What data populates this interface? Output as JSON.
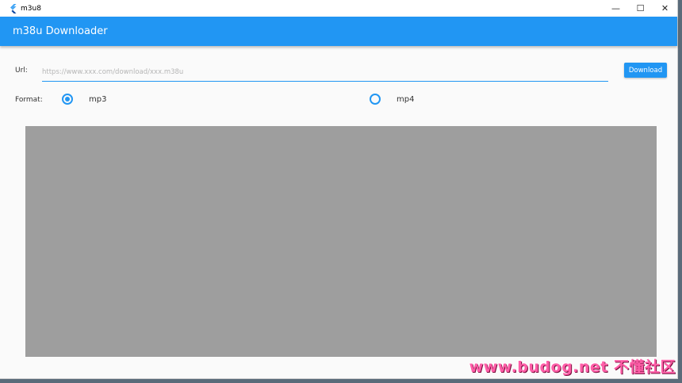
{
  "window": {
    "title": "m3u8",
    "controls": {
      "minimize": "—",
      "maximize": "☐",
      "close": "✕"
    }
  },
  "appbar": {
    "title": "m38u Downloader",
    "color": "#2196f3"
  },
  "form": {
    "url_label": "Url:",
    "url_value": "",
    "url_placeholder": "https://www.xxx.com/download/xxx.m38u",
    "download_label": "Download",
    "format_label": "Format:",
    "options": [
      {
        "label": "mp3",
        "selected": true
      },
      {
        "label": "mp4",
        "selected": false
      }
    ]
  },
  "preview": {
    "color": "#9e9e9e"
  },
  "watermark": "www.budog.net 不懂社区"
}
